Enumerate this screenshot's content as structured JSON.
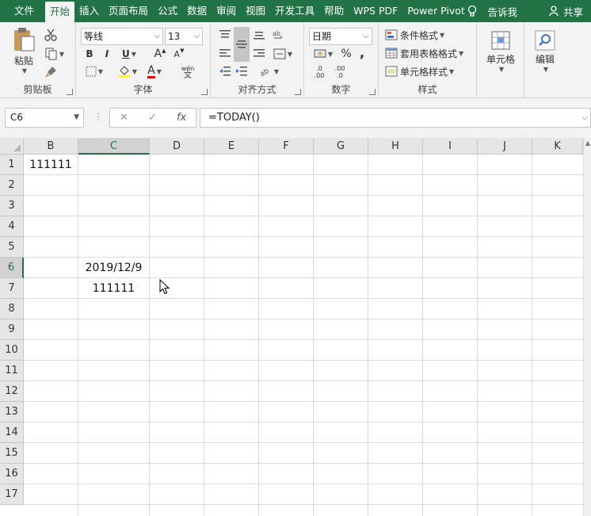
{
  "menu": {
    "tabs": [
      "文件",
      "开始",
      "插入",
      "页面布局",
      "公式",
      "数据",
      "审阅",
      "视图",
      "开发工具",
      "帮助",
      "WPS PDF",
      "Power Pivot"
    ],
    "tell_me": "告诉我",
    "share": "共享"
  },
  "ribbon": {
    "clipboard": {
      "paste": "粘贴",
      "label": "剪贴板"
    },
    "font": {
      "name": "等线",
      "size": "13",
      "bold": "B",
      "italic": "I",
      "underline": "U",
      "grow": "A",
      "color_letter": "A",
      "phonetic_top": "wén",
      "phonetic_bottom": "文",
      "label": "字体"
    },
    "alignment": {
      "label": "对齐方式"
    },
    "number": {
      "format": "日期",
      "percent": "%",
      "comma": ",",
      "inc": ".00",
      "dec": ".0",
      "label": "数字"
    },
    "styles": {
      "conditional": "条件格式",
      "table": "套用表格格式",
      "cell_styles": "单元格样式",
      "label": "样式"
    },
    "cells": {
      "label": "单元格"
    },
    "editing": {
      "label": "编辑"
    }
  },
  "formula_bar": {
    "name_box": "C6",
    "formula": "=TODAY()",
    "cancel": "✕",
    "enter": "✓",
    "fx": "fx"
  },
  "sheet": {
    "columns": [
      "B",
      "C",
      "D",
      "E",
      "F",
      "G",
      "H",
      "I",
      "J",
      "K"
    ],
    "rows": [
      "1",
      "2",
      "3",
      "4",
      "5",
      "6",
      "7",
      "8",
      "9",
      "10",
      "11",
      "12",
      "13",
      "14",
      "15",
      "16",
      "17"
    ],
    "selected_column": "C",
    "selected_row": "6",
    "cells": {
      "B1": "111111",
      "C6": "2019/12/9",
      "C7": "111111"
    }
  },
  "colors": {
    "accent": "#217346",
    "ribbon_bg": "#f3f3f3"
  }
}
